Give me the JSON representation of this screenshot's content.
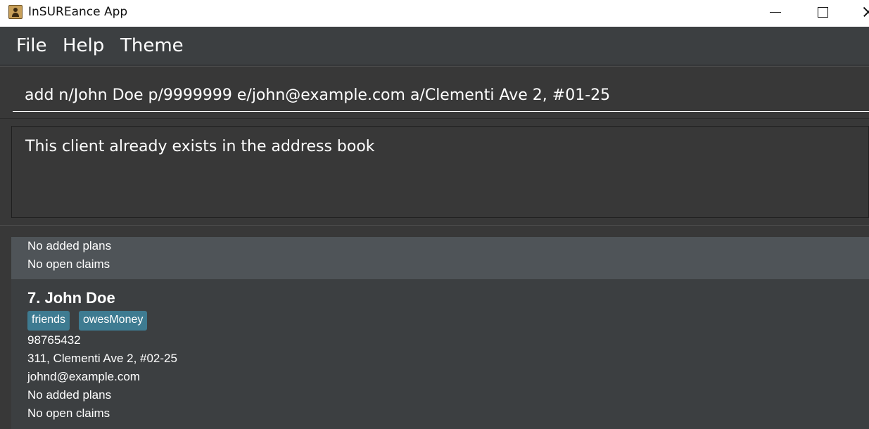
{
  "window": {
    "title": "InSUREance App"
  },
  "menu": {
    "items": [
      "File",
      "Help",
      "Theme"
    ]
  },
  "command_box": {
    "value": "add n/John Doe p/9999999 e/john@example.com a/Clementi Ave 2, #01-25"
  },
  "result_display": {
    "text": "This client already exists in the address book"
  },
  "person_list": {
    "previous_card": {
      "plans": "No added plans",
      "claims": "No open claims"
    },
    "card": {
      "index_name": "7. John Doe",
      "tags": [
        "friends",
        "owesMoney"
      ],
      "phone": "98765432",
      "address": "311, Clementi Ave 2, #02-25",
      "email": "johnd@example.com",
      "plans": "No added plans",
      "claims": "No open claims"
    }
  },
  "colors": {
    "background": "#3c3f41",
    "panel": "#383838",
    "selected_card": "#4f5458",
    "tag": "#3e7b91"
  }
}
